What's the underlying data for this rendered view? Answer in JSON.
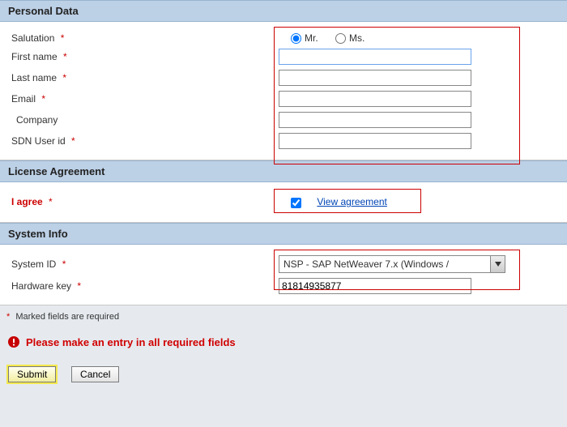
{
  "sections": {
    "personal": {
      "title": "Personal Data",
      "fields": {
        "salutation": {
          "label": "Salutation",
          "required": true,
          "options": {
            "mr": "Mr.",
            "ms": "Ms."
          },
          "value": "mr"
        },
        "first_name": {
          "label": "First name",
          "required": true,
          "value": ""
        },
        "last_name": {
          "label": "Last name",
          "required": true,
          "value": ""
        },
        "email": {
          "label": "Email",
          "required": true,
          "value": ""
        },
        "company": {
          "label": "Company",
          "required": false,
          "value": ""
        },
        "sdn": {
          "label": "SDN User id",
          "required": true,
          "value": ""
        }
      }
    },
    "license": {
      "title": "License Agreement",
      "agree_label": "I agree",
      "agree_required": true,
      "agree_checked": true,
      "view_link": "View agreement"
    },
    "system": {
      "title": "System Info",
      "system_id": {
        "label": "System ID",
        "required": true,
        "selected": "NSP - SAP NetWeaver 7.x (Windows / "
      },
      "hw_key": {
        "label": "Hardware key",
        "required": true,
        "value": "81814935877"
      }
    }
  },
  "required_note": "Marked fields are required",
  "error_message": "Please make an entry in all required fields",
  "buttons": {
    "submit": "Submit",
    "cancel": "Cancel"
  }
}
